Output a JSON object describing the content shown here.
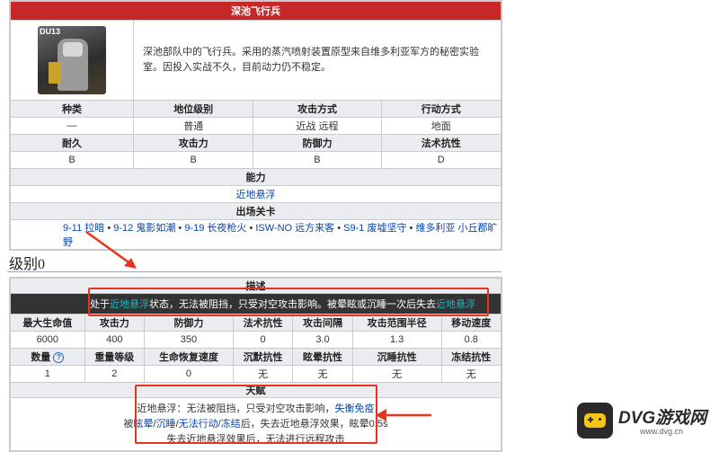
{
  "enemy": {
    "name": "深池飞行兵",
    "portrait_tag": "DU13",
    "description": "深池部队中的飞行兵。采用的蒸汽喷射装置原型来自维多利亚军方的秘密实验室。因投入实战不久，目前动力仍不稳定。",
    "info_headers": [
      "种类",
      "地位级别",
      "攻击方式",
      "行动方式"
    ],
    "info_values": [
      "—",
      "普通",
      "近战 远程",
      "地面"
    ],
    "stat_headers": [
      "耐久",
      "攻击力",
      "防御力",
      "法术抗性"
    ],
    "stat_values": [
      "B",
      "B",
      "B",
      "D"
    ],
    "ability_header": "能力",
    "ability_value": "近地悬浮",
    "stage_header": "出场关卡",
    "stages": [
      "9-11 拉暗",
      "9-12 鬼影如潮",
      "9-19 长夜枪火",
      "ISW-NO 远方来客",
      "S9-1 废墟坚守",
      "维多利亚 小丘郡旷野"
    ]
  },
  "level_section": {
    "title": "级别0",
    "desc_header": "描述",
    "desc_prefix": "处于",
    "desc_link1": "近地悬浮",
    "desc_middle": "状态，无法被阻挡，只受对空攻击影响。被晕眩或沉睡一次后失去",
    "desc_link2": "近地悬浮",
    "row1_headers": [
      "最大生命值",
      "攻击力",
      "防御力",
      "法术抗性",
      "攻击间隔",
      "攻击范围半径",
      "移动速度"
    ],
    "row1_values": [
      "6000",
      "400",
      "350",
      "0",
      "3.0",
      "1.3",
      "0.8"
    ],
    "row2_headers": [
      "数量",
      "重量等级",
      "生命恢复速度",
      "沉默抗性",
      "眩晕抗性",
      "沉睡抗性",
      "冻结抗性"
    ],
    "row2_values": [
      "1",
      "2",
      "0",
      "无",
      "无",
      "无",
      "无"
    ],
    "talent_header": "天赋",
    "talent_line1_prefix": "近地悬浮：无法被阻挡，只受对空攻击影响，",
    "talent_line1_link": "失衡免疫",
    "talent_line2_prefix": "被",
    "talent_link_a": "眩晕",
    "talent_link_b": "沉睡",
    "talent_link_c": "无法行动",
    "talent_link_d": "冻结",
    "talent_line2_suffix": "后，失去近地悬浮效果，眩晕0.5s",
    "talent_line3": "失去近地悬浮效果后，无法进行远程攻击"
  },
  "watermark": {
    "brand": "DVG游戏网",
    "url": "www.dvg.cn"
  },
  "colors": {
    "header_red": "#c62828",
    "link": "#0645ad",
    "teal": "#1bb7c4",
    "annotation": "#e8341c",
    "logo_bg": "#2a2a2a",
    "logo_yellow": "#f5c518"
  }
}
